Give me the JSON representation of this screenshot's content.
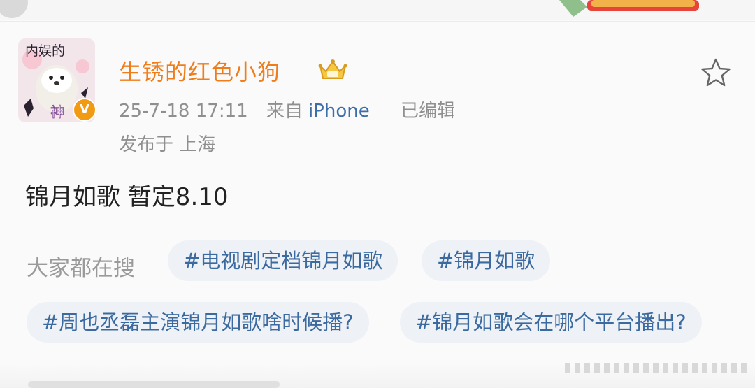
{
  "post": {
    "username": "生锈的红色小狗",
    "avatar": {
      "text_top": "内娱的",
      "text_bottom": "神"
    },
    "timestamp": "25-7-18 17:11",
    "source_label": "来自",
    "source": "iPhone",
    "edited": "已编辑",
    "location": "发布于 上海",
    "content": "锦月如歌 暂定8.10"
  },
  "search": {
    "label": "大家都在搜",
    "tags": [
      "#电视剧定档锦月如歌",
      "#锦月如歌",
      "#周也丞磊主演锦月如歌啥时候播?",
      "#锦月如歌会在哪个平台播出?"
    ]
  },
  "icons": {
    "crown": "crown-badge-icon",
    "star": "star-icon",
    "verified": "verified-badge-icon"
  },
  "colors": {
    "username": "#ef7d1a",
    "link": "#3e6ea8",
    "tag_bg": "#eef1f5",
    "tag_text": "#3b6aa0",
    "meta": "#8f8f8f",
    "verified": "#f29a12"
  }
}
